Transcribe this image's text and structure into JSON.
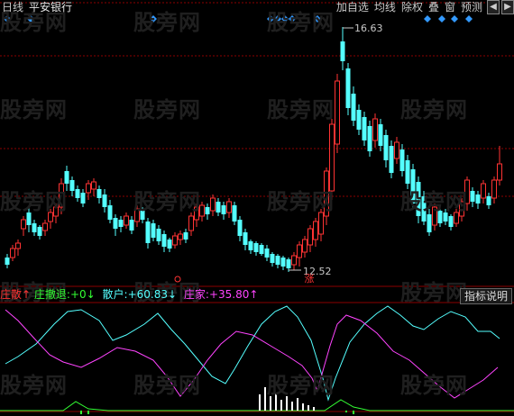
{
  "header": {
    "chart_mode": "日线",
    "stock_name": "平安银行"
  },
  "toolbar": {
    "items": [
      "加自选",
      "均线",
      "除权",
      "叠",
      "窗",
      "预测"
    ]
  },
  "price_labels": {
    "high": "16.63",
    "low": "12.52"
  },
  "rise_badge": "涨",
  "indicator": {
    "name": "庄散",
    "line1_label": "庄撤退:",
    "line1_value": "+0",
    "line2_label": "散户:",
    "line2_value": "+60.83",
    "line3_label": "庄家:",
    "line3_value": "+35.80",
    "help_button": "指标说明"
  },
  "watermark": "股旁网",
  "colors": {
    "up": "#ff3333",
    "down": "#54ffff",
    "indicator_name": "#ff3333",
    "retreat": "#33ff33",
    "retail": "#54ffff",
    "dealer": "#ff44ff",
    "grid": "#8b0000"
  }
}
